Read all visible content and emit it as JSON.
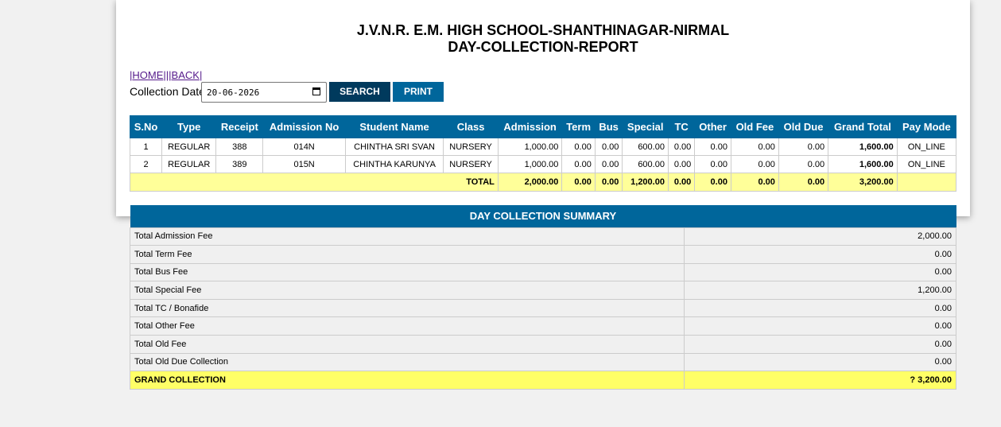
{
  "header": {
    "school": "J.V.N.R. E.M. HIGH SCHOOL-SHANTHINAGAR-NIRMAL",
    "report": "DAY-COLLECTION-REPORT"
  },
  "nav": {
    "prefix": "|",
    "home": "HOME",
    "sep": "|||",
    "back": "BACK",
    "suffix": "|"
  },
  "filter": {
    "label": "Collection Date",
    "date": "20-06-2026"
  },
  "buttons": {
    "search": "SEARCH",
    "print": "PRINT"
  },
  "table": {
    "headers": [
      "S.No",
      "Type",
      "Receipt",
      "Admission No",
      "Student Name",
      "Class",
      "Admission",
      "Term",
      "Bus",
      "Special",
      "TC",
      "Other",
      "Old Fee",
      "Old Due",
      "Grand Total",
      "Pay Mode"
    ],
    "rows": [
      [
        "1",
        "REGULAR",
        "388",
        "014N",
        "CHINTHA SRI SVAN",
        "NURSERY",
        "1,000.00",
        "0.00",
        "0.00",
        "600.00",
        "0.00",
        "0.00",
        "0.00",
        "0.00",
        "1,600.00",
        "ON_LINE"
      ],
      [
        "2",
        "REGULAR",
        "389",
        "015N",
        "CHINTHA KARUNYA",
        "NURSERY",
        "1,000.00",
        "0.00",
        "0.00",
        "600.00",
        "0.00",
        "0.00",
        "0.00",
        "0.00",
        "1,600.00",
        "ON_LINE"
      ]
    ],
    "total": {
      "label": "TOTAL",
      "values": [
        "2,000.00",
        "0.00",
        "0.00",
        "1,200.00",
        "0.00",
        "0.00",
        "0.00",
        "0.00",
        "3,200.00"
      ]
    }
  },
  "summary": {
    "title": "DAY COLLECTION SUMMARY",
    "items": [
      {
        "label": "Total Admission Fee",
        "value": "2,000.00"
      },
      {
        "label": "Total Term Fee",
        "value": "0.00"
      },
      {
        "label": "Total Bus Fee",
        "value": "0.00"
      },
      {
        "label": "Total Special Fee",
        "value": "1,200.00"
      },
      {
        "label": "Total TC / Bonafide",
        "value": "0.00"
      },
      {
        "label": "Total Other Fee",
        "value": "0.00"
      },
      {
        "label": "Total Old Fee",
        "value": "0.00"
      },
      {
        "label": "Total Old Due Collection",
        "value": "0.00"
      }
    ],
    "grand_label": "GRAND COLLECTION",
    "grand_value": "? 3,200.00"
  },
  "colors": {
    "header_blue": "#00669b",
    "search_button": "#003a5d",
    "total_row": "#ffff99",
    "grand_row": "#ffff66"
  }
}
